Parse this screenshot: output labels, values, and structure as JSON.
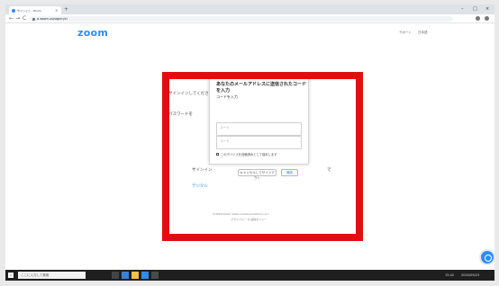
{
  "browser": {
    "tab_title": "サインイン - Zoom",
    "tab_close": "×",
    "new_tab": "+",
    "window_controls": [
      "–",
      "□",
      "×"
    ],
    "nav": {
      "back": "←",
      "forward": "→",
      "reload": "C"
    },
    "url": "a zoom.us/signin/cl"
  },
  "page": {
    "logo": "zoom",
    "header_links": [
      "サポート",
      "日本語"
    ],
    "background_lines": [
      "サインインしてください",
      "パスワードを",
      "サインイン",
      "で",
      "デジタル"
    ],
    "footer_lines": [
      "©2020 Zoom Video Communications, Inc.",
      "プライバシー & 法的ポリシー"
    ]
  },
  "modal": {
    "title": "あなたのメールアドレスに送信されたコードを入力",
    "subtitle": "コードを入力",
    "code_placeholder": "コード",
    "code_label": "コード",
    "remember_label": "このデバイスを信頼済みとして保存します",
    "cancel_label": "キャンセルしてサインアウト",
    "ok_label": "確認"
  },
  "taskbar": {
    "search_placeholder": "ここに入力して検索",
    "time": "15:42",
    "date": "2020/09/23"
  },
  "colors": {
    "brand": "#2d8cff",
    "highlight": "#e10e0e"
  }
}
